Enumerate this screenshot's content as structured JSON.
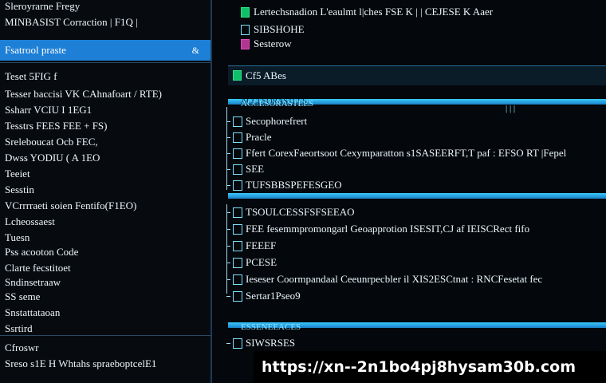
{
  "left_panel": {
    "rows": [
      "Sleroyrarne Fregy",
      "MINBASIST Corraction | F1Q |",
      "Fsatrool praste",
      "Teset 5FIG f",
      "Tesser baccisi VK CAhnafoart / RTE)",
      "Ssharr VCIU I 1EG1",
      "Tesstrs FEES FEE + FS)",
      "Sreleboucat Ocb FEC,",
      "Dwss YODIU ( A 1EO",
      "Teeiet",
      "Sesstin",
      "VCrrrraeti soien Fentifo(F1EO)",
      "Lcheossaest",
      "Tuesn",
      "Pss acooton Code",
      "Clarte fecstitoet",
      "Sndinsetraaw",
      "SS seme",
      "Snstattataoan",
      "Ssrtird",
      "Cfroswr",
      "Sreso  s1E  H  Whtahs spraeboptcelE1"
    ],
    "selected_pin": "&"
  },
  "right_panel": {
    "top_rows": [
      "Lertechsnadion  L'eaulmt  l|ches  FSE  K  |  |  CEJESE  K  Aaer",
      "SIBSHOHE",
      "Sesterow"
    ],
    "section_header": "Cf5 ABes",
    "tree_rows_1": [
      "ACCESORASTEES",
      "Secophorefrert",
      "Pracle",
      "Ffert  CorexFaeortsoot  Cexymparatton  s1SASEERFT,T  paf  : EFSO  RT  |Fepel",
      "SEE",
      "TUFSBBSPEFESGEO"
    ],
    "tree_rows_2": [
      "TSOULCESSFSFSEEAO",
      "FEE  fesemmpromongarl  Geoapprotion  ISESIT,CJ  af  IEISCRect  fifo",
      "FEEEF",
      "PCESE",
      "Ieseser  Coormpandaal  Ceeunrpecbler  il  XIS2ESCtnat  :  RNCFesetat  fec",
      "Sertar1Pseo9"
    ],
    "tree_rows_3": [
      "ESSENEEACES",
      "SIWSRSES"
    ],
    "header_marks": "|   |   |"
  },
  "watermark": {
    "url": "https://xn--2n1bo4pj8hysam30b.com"
  },
  "colors": {
    "selection": "#1d7fd6",
    "accent_bar": "#38c9ff",
    "checkbox_green": "#0fbf6a",
    "checkbox_magenta": "#b0368f",
    "background": "#05080c"
  }
}
